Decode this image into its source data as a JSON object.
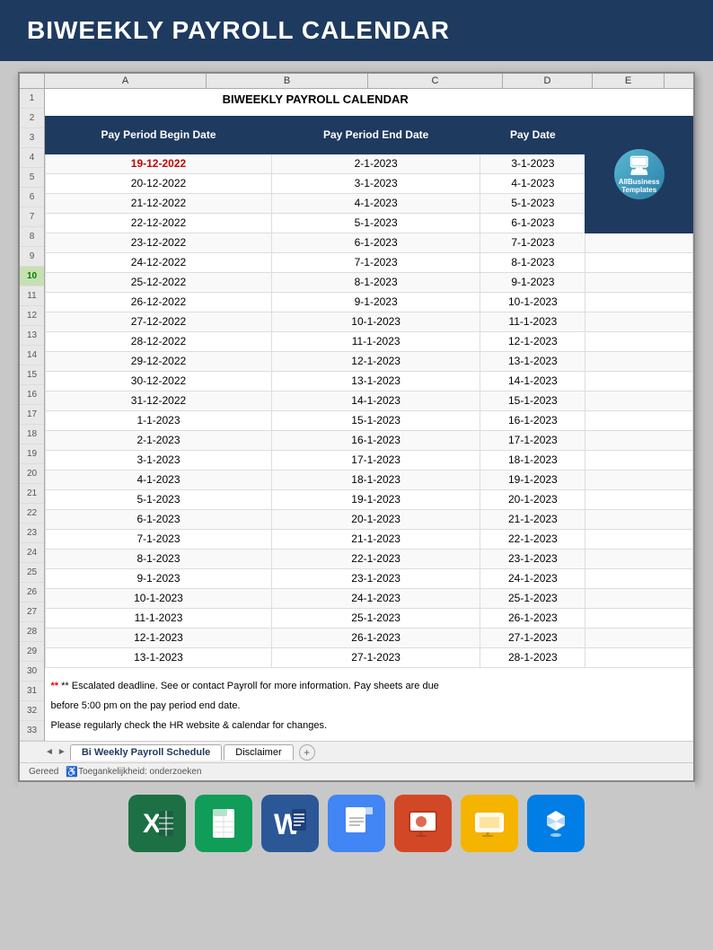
{
  "header": {
    "title": "BIWEEKLY PAYROLL CALENDAR",
    "bg_color": "#1e3a5f",
    "text_color": "#ffffff"
  },
  "spreadsheet": {
    "title": "BIWEEKLY PAYROLL CALENDAR",
    "columns": {
      "a": "A",
      "b": "B",
      "c": "C",
      "d": "D",
      "e": "E"
    },
    "col_headers": [
      "Pay Period Begin Date",
      "Pay Period End Date",
      "Pay Date"
    ],
    "rows": [
      {
        "begin": "19-12-2022",
        "end": "2-1-2023",
        "pay": "3-1-2023",
        "red": true
      },
      {
        "begin": "20-12-2022",
        "end": "3-1-2023",
        "pay": "4-1-2023"
      },
      {
        "begin": "21-12-2022",
        "end": "4-1-2023",
        "pay": "5-1-2023"
      },
      {
        "begin": "22-12-2022",
        "end": "5-1-2023",
        "pay": "6-1-2023"
      },
      {
        "begin": "23-12-2022",
        "end": "6-1-2023",
        "pay": "7-1-2023"
      },
      {
        "begin": "24-12-2022",
        "end": "7-1-2023",
        "pay": "8-1-2023"
      },
      {
        "begin": "25-12-2022",
        "end": "8-1-2023",
        "pay": "9-1-2023"
      },
      {
        "begin": "26-12-2022",
        "end": "9-1-2023",
        "pay": "10-1-2023"
      },
      {
        "begin": "27-12-2022",
        "end": "10-1-2023",
        "pay": "11-1-2023"
      },
      {
        "begin": "28-12-2022",
        "end": "11-1-2023",
        "pay": "12-1-2023"
      },
      {
        "begin": "29-12-2022",
        "end": "12-1-2023",
        "pay": "13-1-2023"
      },
      {
        "begin": "30-12-2022",
        "end": "13-1-2023",
        "pay": "14-1-2023"
      },
      {
        "begin": "31-12-2022",
        "end": "14-1-2023",
        "pay": "15-1-2023"
      },
      {
        "begin": "1-1-2023",
        "end": "15-1-2023",
        "pay": "16-1-2023"
      },
      {
        "begin": "2-1-2023",
        "end": "16-1-2023",
        "pay": "17-1-2023"
      },
      {
        "begin": "3-1-2023",
        "end": "17-1-2023",
        "pay": "18-1-2023"
      },
      {
        "begin": "4-1-2023",
        "end": "18-1-2023",
        "pay": "19-1-2023"
      },
      {
        "begin": "5-1-2023",
        "end": "19-1-2023",
        "pay": "20-1-2023"
      },
      {
        "begin": "6-1-2023",
        "end": "20-1-2023",
        "pay": "21-1-2023"
      },
      {
        "begin": "7-1-2023",
        "end": "21-1-2023",
        "pay": "22-1-2023"
      },
      {
        "begin": "8-1-2023",
        "end": "22-1-2023",
        "pay": "23-1-2023"
      },
      {
        "begin": "9-1-2023",
        "end": "23-1-2023",
        "pay": "24-1-2023"
      },
      {
        "begin": "10-1-2023",
        "end": "24-1-2023",
        "pay": "25-1-2023"
      },
      {
        "begin": "11-1-2023",
        "end": "25-1-2023",
        "pay": "26-1-2023"
      },
      {
        "begin": "12-1-2023",
        "end": "26-1-2023",
        "pay": "27-1-2023"
      },
      {
        "begin": "13-1-2023",
        "end": "27-1-2023",
        "pay": "28-1-2023"
      }
    ],
    "notes": [
      "** Escalated deadline. See  or contact Payroll for more information. Pay sheets are due",
      "before 5:00 pm on the pay period end date.",
      "Please regularly check the HR website & calendar for changes."
    ],
    "logo": {
      "line1": "AllBusiness",
      "line2": "Templates"
    }
  },
  "tabs": [
    {
      "label": "Bi Weekly Payroll Schedule",
      "active": true
    },
    {
      "label": "Disclaimer",
      "active": false
    }
  ],
  "status_bar": {
    "text": "Gereed",
    "accessibility": "Toegankelijkheid: onderzoeken"
  },
  "app_icons": [
    {
      "name": "Excel",
      "color": "#1d7044",
      "symbol": "X"
    },
    {
      "name": "Google Sheets",
      "color": "#0f9d58",
      "symbol": "S"
    },
    {
      "name": "Word",
      "color": "#2b5797",
      "symbol": "W"
    },
    {
      "name": "Google Docs",
      "color": "#4285f4",
      "symbol": "D"
    },
    {
      "name": "PowerPoint",
      "color": "#d24726",
      "symbol": "P"
    },
    {
      "name": "Google Slides",
      "color": "#f4b400",
      "symbol": "G"
    },
    {
      "name": "Dropbox",
      "color": "#007ee5",
      "symbol": "❑"
    }
  ],
  "row_numbers": [
    "1",
    "2",
    "3",
    "4",
    "5",
    "6",
    "7",
    "8",
    "9",
    "10",
    "11",
    "12",
    "13",
    "14",
    "15",
    "16",
    "17",
    "18",
    "19",
    "20",
    "21",
    "22",
    "23",
    "24",
    "25",
    "26",
    "27",
    "28",
    "29",
    "30",
    "31",
    "32",
    "33"
  ]
}
